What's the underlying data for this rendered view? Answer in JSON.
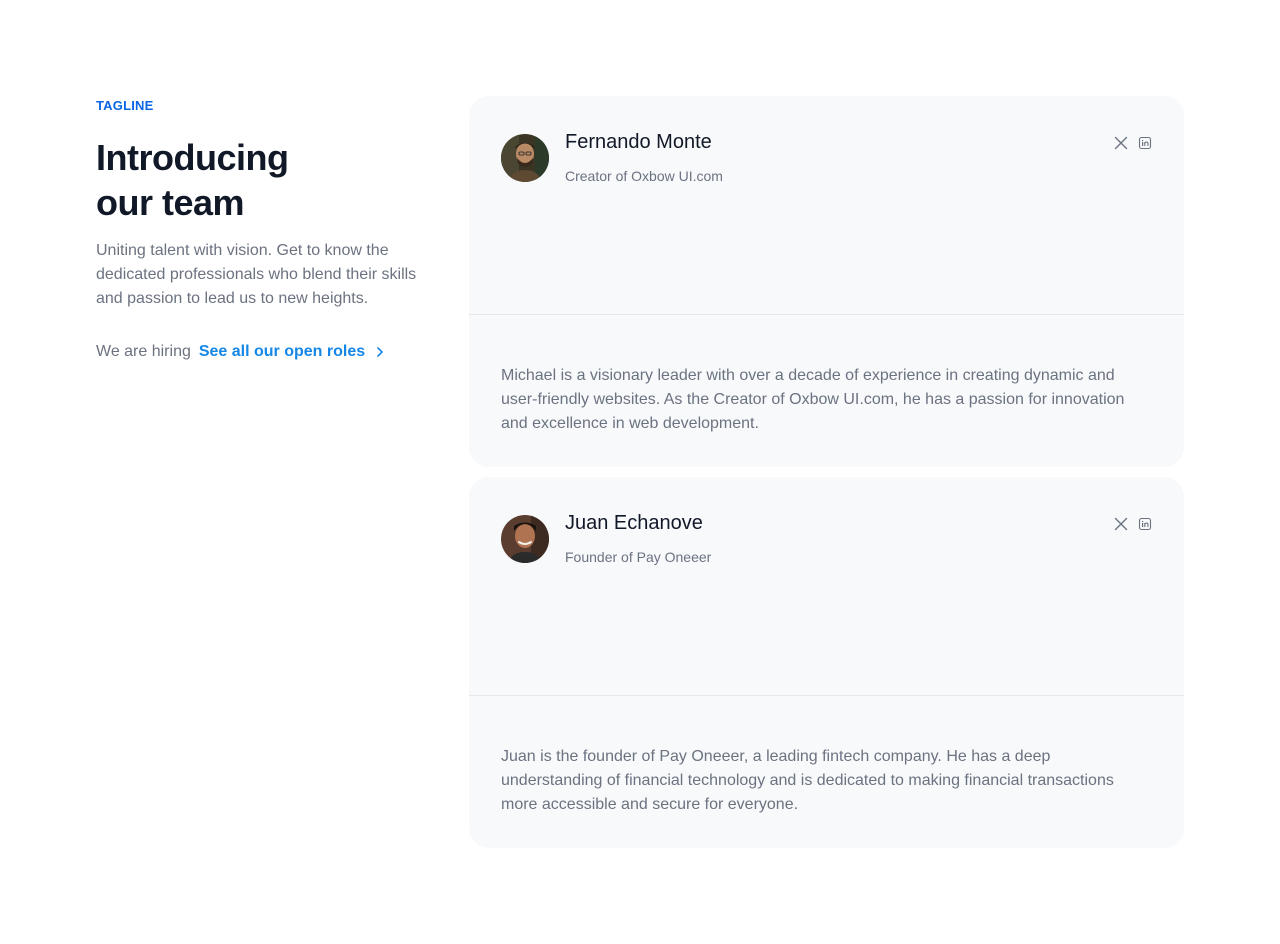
{
  "intro": {
    "tagline": "TAGLINE",
    "title_line1": "Introducing",
    "title_line2": "our team",
    "subtitle": "Uniting talent with vision. Get to know the dedicated professionals who blend their skills and passion to lead us to new heights.",
    "hiring_text": "We are hiring",
    "roles_link": "See all our open roles"
  },
  "members": [
    {
      "name": "Fernando Monte",
      "role": "Creator of Oxbow UI.com",
      "bio": "Michael is a visionary leader with over a decade of experience in creating dynamic and user-friendly websites. As the Creator of Oxbow UI.com, he has a passion for innovation and excellence in web development.",
      "socials": [
        "x-icon",
        "linkedin-icon"
      ]
    },
    {
      "name": "Juan Echanove",
      "role": "Founder of Pay Oneeer",
      "bio": "Juan is the founder of Pay Oneeer, a leading fintech company. He has a deep understanding of financial technology and is dedicated to making financial transactions more accessible and secure for everyone.",
      "socials": [
        "x-icon",
        "linkedin-icon"
      ]
    }
  ],
  "colors": {
    "accent": "#0b66e4",
    "link": "#1687e6",
    "heading": "#111827",
    "muted": "#6b7280",
    "card_bg": "#f8f9fb"
  }
}
